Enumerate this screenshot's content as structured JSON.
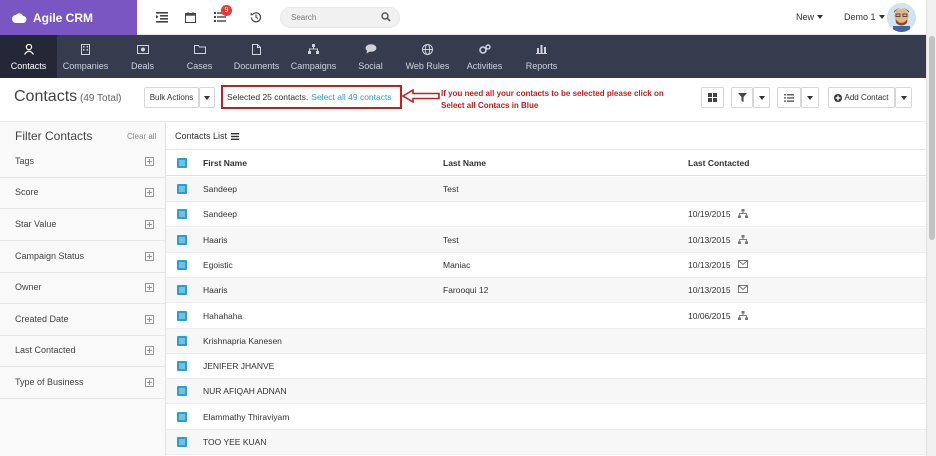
{
  "app": {
    "name": "Agile CRM"
  },
  "topbar": {
    "notification_count": "9",
    "search_placeholder": "Search",
    "new_label": "New",
    "user_label": "Demo 1"
  },
  "nav": {
    "items": [
      {
        "label": "Contacts"
      },
      {
        "label": "Companies"
      },
      {
        "label": "Deals"
      },
      {
        "label": "Cases"
      },
      {
        "label": "Documents"
      },
      {
        "label": "Campaigns"
      },
      {
        "label": "Social"
      },
      {
        "label": "Web Rules"
      },
      {
        "label": "Activities"
      },
      {
        "label": "Reports"
      }
    ]
  },
  "page": {
    "title": "Contacts",
    "count": "(49 Total)",
    "bulk_actions": "Bulk Actions",
    "selected_text": "Selected 25 contacts.",
    "select_all_link": "Select all 49 contacts",
    "annotation_line1": "If you need all your contacts to be selected please click on",
    "annotation_line2": "Select all Contacs in Blue",
    "add_contact": "Add Contact"
  },
  "filter": {
    "title": "Filter Contacts",
    "clear_all": "Clear all",
    "items": [
      "Tags",
      "Score",
      "Star Value",
      "Campaign Status",
      "Owner",
      "Created Date",
      "Last Contacted",
      "Type of Business"
    ]
  },
  "list": {
    "title": "Contacts List",
    "columns": [
      "First Name",
      "Last Name",
      "Last Contacted"
    ],
    "rows": [
      {
        "first": "Sandeep",
        "last": "Test",
        "contacted": "",
        "icon": ""
      },
      {
        "first": "Sandeep",
        "last": "",
        "contacted": "10/19/2015",
        "icon": "sitemap-icon"
      },
      {
        "first": "Haaris",
        "last": "Test",
        "contacted": "10/13/2015",
        "icon": "sitemap-icon"
      },
      {
        "first": "Egoistic",
        "last": "Maniac",
        "contacted": "10/13/2015",
        "icon": "envelope-icon"
      },
      {
        "first": "Haaris",
        "last": "Farooqui 12",
        "contacted": "10/13/2015",
        "icon": "envelope-icon"
      },
      {
        "first": "Hahahaha",
        "last": "",
        "contacted": "10/06/2015",
        "icon": "sitemap-icon"
      },
      {
        "first": "Krishnapria Kanesen",
        "last": "",
        "contacted": "",
        "icon": ""
      },
      {
        "first": "JENIFER JHANVE",
        "last": "",
        "contacted": "",
        "icon": ""
      },
      {
        "first": "NUR AFIQAH ADNAN",
        "last": "",
        "contacted": "",
        "icon": ""
      },
      {
        "first": "Elammathy Thiraviyam",
        "last": "",
        "contacted": "",
        "icon": ""
      },
      {
        "first": "TOO YEE KUAN",
        "last": "",
        "contacted": "",
        "icon": ""
      }
    ]
  },
  "colors": {
    "brand": "#7a56c2",
    "nav_bg": "#363b4d",
    "accent": "#2a9fd0",
    "annotation": "#c41f1f"
  }
}
